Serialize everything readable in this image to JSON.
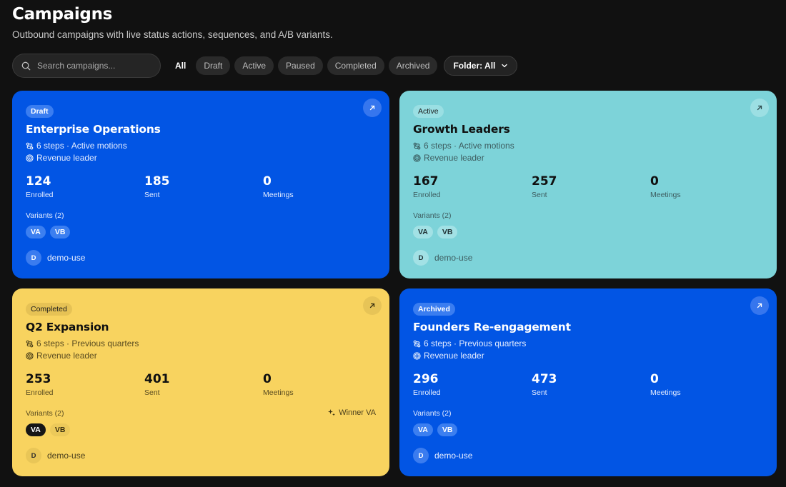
{
  "page": {
    "title": "Campaigns",
    "subtitle": "Outbound campaigns with live status actions, sequences, and A/B variants."
  },
  "toolbar": {
    "search_placeholder": "Search campaigns...",
    "filters": [
      "All",
      "Draft",
      "Active",
      "Paused",
      "Completed",
      "Archived"
    ],
    "selected_filter": "All",
    "folder_label": "Folder: All"
  },
  "campaigns": [
    {
      "status": "Draft",
      "name": "Enterprise Operations",
      "steps": "6 steps · Active motions",
      "owner_role": "Revenue leader",
      "enrolled": "124",
      "enrolled_label": "Enrolled",
      "sent": "185",
      "sent_label": "Sent",
      "meetings": "0",
      "meetings_label": "Meetings",
      "variants_label": "Variants (2)",
      "variants": [
        "VA",
        "VB"
      ],
      "winner": "",
      "user_initial": "D",
      "user": "demo-use",
      "theme": "blue",
      "color": "#0255e4"
    },
    {
      "status": "Active",
      "name": "Growth Leaders",
      "steps": "6 steps · Active motions",
      "owner_role": "Revenue leader",
      "enrolled": "167",
      "enrolled_label": "Enrolled",
      "sent": "257",
      "sent_label": "Sent",
      "meetings": "0",
      "meetings_label": "Meetings",
      "variants_label": "Variants (2)",
      "variants": [
        "VA",
        "VB"
      ],
      "winner": "",
      "user_initial": "D",
      "user": "demo-use",
      "theme": "teal",
      "color": "#7dd3d9"
    },
    {
      "status": "Completed",
      "name": "Q2 Expansion",
      "steps": "6 steps · Previous quarters",
      "owner_role": "Revenue leader",
      "enrolled": "253",
      "enrolled_label": "Enrolled",
      "sent": "401",
      "sent_label": "Sent",
      "meetings": "0",
      "meetings_label": "Meetings",
      "variants_label": "Variants (2)",
      "variants": [
        "VA",
        "VB"
      ],
      "winner": "Winner VA",
      "user_initial": "D",
      "user": "demo-use",
      "theme": "yellow",
      "color": "#f8d35f"
    },
    {
      "status": "Archived",
      "name": "Founders Re-engagement",
      "steps": "6 steps · Previous quarters",
      "owner_role": "Revenue leader",
      "enrolled": "296",
      "enrolled_label": "Enrolled",
      "sent": "473",
      "sent_label": "Sent",
      "meetings": "0",
      "meetings_label": "Meetings",
      "variants_label": "Variants (2)",
      "variants": [
        "VA",
        "VB"
      ],
      "winner": "",
      "user_initial": "D",
      "user": "demo-use",
      "theme": "blue",
      "color": "#0255e4"
    }
  ],
  "icons": {
    "search": "search-icon",
    "chevron": "chevron-down-icon",
    "open": "arrow-up-right-icon",
    "steps": "route-icon",
    "owner": "target-icon",
    "winner": "sparkles-icon"
  }
}
